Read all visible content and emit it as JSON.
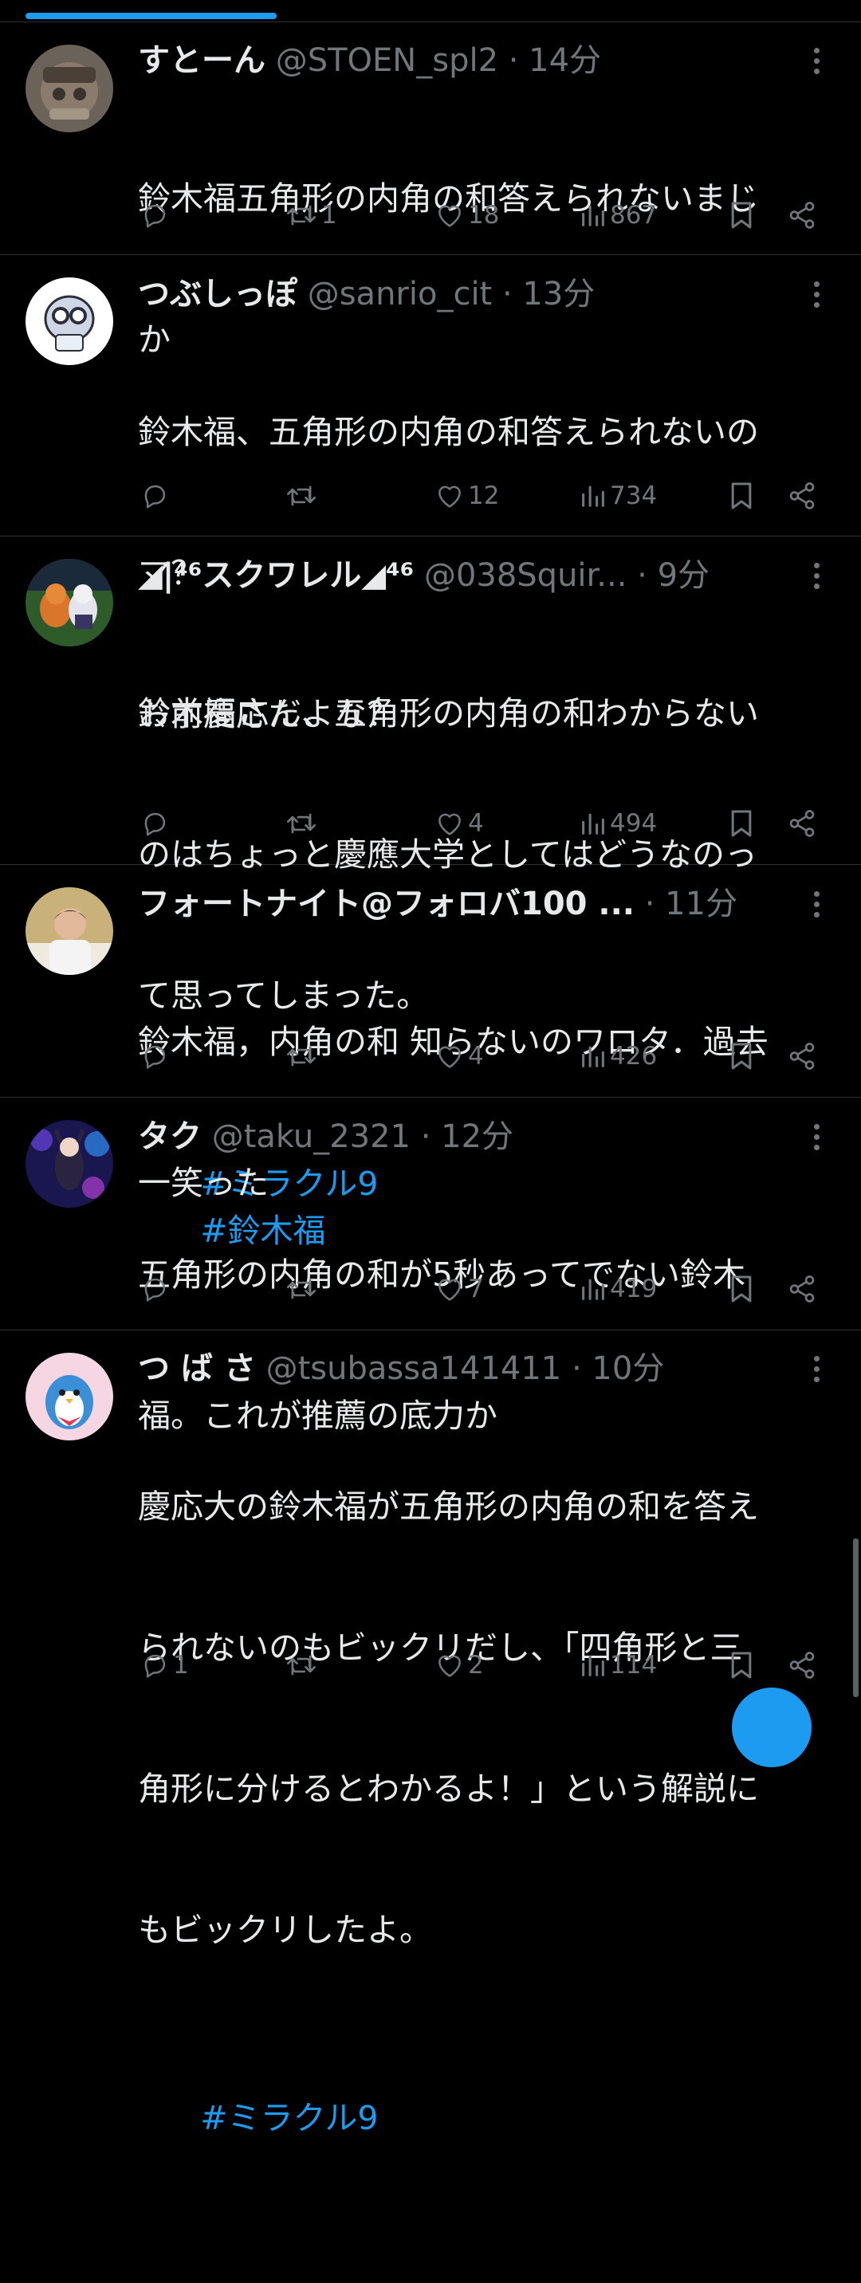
{
  "theme": {
    "accent": "#1d9bf0",
    "background": "#000000",
    "muted": "#71767b",
    "text": "#e7e9ea"
  },
  "tweets": [
    {
      "display_name": "すとーん",
      "handle": "@STOEN_spl2",
      "separator": "·",
      "time": "14分",
      "body_lines": [
        "鈴木福五角形の内角の和答えられないまじ",
        "か"
      ],
      "reply_count": "",
      "retweet_count": "1",
      "like_count": "18",
      "view_count": "867"
    },
    {
      "display_name": "つぶしっぽ",
      "handle": "@sanrio_cit",
      "separator": "·",
      "time": "13分",
      "body_lines": [
        "鈴木福、五角形の内角の和答えられないの",
        "マ？",
        "お前慶応だよな？"
      ],
      "reply_count": "",
      "retweet_count": "",
      "like_count": "12",
      "view_count": "734"
    },
    {
      "display_name": "◢|⁴⁶スクワレル◢⁴⁶",
      "handle": "@038Squir...",
      "separator": "·",
      "time": "9分",
      "body_lines": [
        "鈴木福さん、五角形の内角の和わからない",
        "のはちょっと慶應大学としてはどうなのっ",
        "て思ってしまった。"
      ],
      "hashtags": [
        "#ミラクル9",
        "#鈴木福"
      ],
      "reply_count": "",
      "retweet_count": "",
      "like_count": "4",
      "view_count": "494"
    },
    {
      "display_name": "フォートナイト@フォロバ100 ...",
      "handle": "",
      "separator": "·",
      "time": "11分",
      "body_lines": [
        "鈴木福，内角の和 知らないのワロタ．過去",
        "一笑った"
      ],
      "reply_count": "",
      "retweet_count": "",
      "like_count": "4",
      "view_count": "426"
    },
    {
      "display_name": "タク",
      "handle": "@taku_2321",
      "separator": "·",
      "time": "12分",
      "body_lines": [
        "五角形の内角の和が5秒あってでない鈴木",
        "福。これが推薦の底力か"
      ],
      "reply_count": "",
      "retweet_count": "",
      "like_count": "7",
      "view_count": "419"
    },
    {
      "display_name": "つ ば さ",
      "handle": "@tsubassa141411",
      "separator": "·",
      "time": "10分",
      "body_lines": [
        "慶応大の鈴木福が五角形の内角の和を答え",
        "られないのもビックリだし、「四角形と三",
        "角形に分けるとわかるよ！」という解説に",
        "もビックリしたよ。"
      ],
      "hashtags": [
        "#ミラクル9"
      ],
      "reply_count": "1",
      "retweet_count": "",
      "like_count": "2",
      "view_count": "114"
    }
  ]
}
